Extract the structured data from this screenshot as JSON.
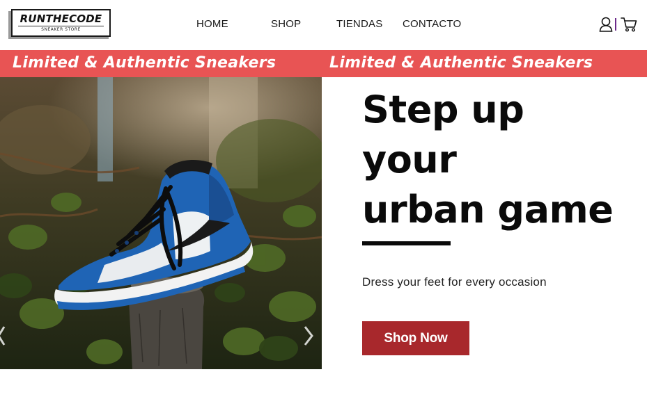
{
  "header": {
    "logo": {
      "title": "RUNTHECODE",
      "subtitle": "SNEAKER STORE"
    },
    "nav": [
      {
        "label": "HOME"
      },
      {
        "label": "SHOP"
      },
      {
        "label": "TIENDAS"
      },
      {
        "label": "CONTACTO"
      }
    ],
    "icons": [
      "user-icon",
      "cart-icon"
    ]
  },
  "marquee": {
    "text": "Limited & Authentic Sneakers",
    "background": "#e85454"
  },
  "hero": {
    "image": "blue-white-high-top-sneaker-on-tree-stump-among-ivy",
    "title_lines": [
      "Step up",
      "your",
      "urban game"
    ],
    "subtitle": "Dress your feet for every occasion",
    "cta_label": "Shop Now",
    "cta_color": "#a8282c"
  }
}
